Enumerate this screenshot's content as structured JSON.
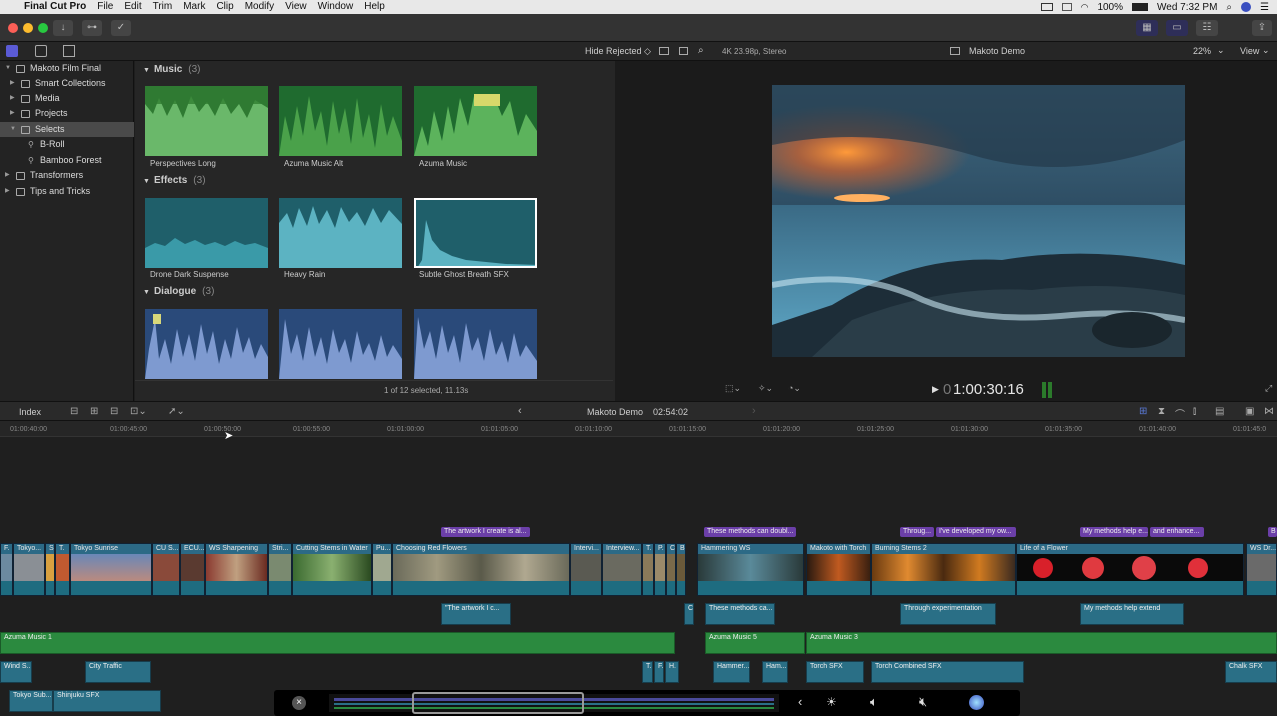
{
  "menubar": {
    "app": "Final Cut Pro",
    "items": [
      "File",
      "Edit",
      "Trim",
      "Mark",
      "Clip",
      "Modify",
      "View",
      "Window",
      "Help"
    ],
    "battery": "100%",
    "clock": "Wed 7:32 PM"
  },
  "bar2": {
    "hide_rejected": "Hide Rejected ◇",
    "format": "4K 23.98p, Stereo",
    "project": "Makoto Demo",
    "zoom": "22%",
    "view": "View"
  },
  "sidebar": {
    "items": [
      {
        "label": "Makoto Film Final",
        "selected": false
      },
      {
        "label": "Smart Collections",
        "selected": false
      },
      {
        "label": "Media",
        "selected": false
      },
      {
        "label": "Projects",
        "selected": false
      },
      {
        "label": "Selects",
        "selected": true
      },
      {
        "label": "B-Roll",
        "selected": false
      },
      {
        "label": "Bamboo Forest",
        "selected": false
      },
      {
        "label": "Transformers",
        "selected": false
      },
      {
        "label": "Tips and Tricks",
        "selected": false
      }
    ]
  },
  "browser": {
    "sections": [
      {
        "title": "Music",
        "count": "(3)",
        "clips": [
          "Perspectives Long",
          "Azuma Music Alt",
          "Azuma Music"
        ]
      },
      {
        "title": "Effects",
        "count": "(3)",
        "clips": [
          "Drone Dark Suspense",
          "Heavy Rain",
          "Subtle Ghost Breath SFX"
        ]
      },
      {
        "title": "Dialogue",
        "count": "(3)",
        "clips": [
          "",
          "",
          ""
        ]
      }
    ],
    "status": "1 of 12 selected, 11.13s"
  },
  "viewer": {
    "timecode": "1:00:30:16",
    "timecode_prefix": "0"
  },
  "timeline": {
    "index": "Index",
    "project": "Makoto Demo",
    "duration": "02:54:02",
    "ruler": [
      "01:00:40:00",
      "01:00:45:00",
      "01:00:50:00",
      "01:00:55:00",
      "01:01:00:00",
      "01:01:05:00",
      "01:01:10:00",
      "01:01:15:00",
      "01:01:20:00",
      "01:01:25:00",
      "01:01:30:00",
      "01:01:35:00",
      "01:01:40:00",
      "01:01:45:0"
    ],
    "titles": [
      "The artwork I create is al...",
      "These methods can doubl...",
      "Throug...",
      "I've developed my ow...",
      "My methods help e...",
      "and enhance...",
      "B"
    ],
    "primary": [
      "F.",
      "Tokyo...",
      "S.",
      "T.",
      "Tokyo Sunrise",
      "CU S...",
      "ECU...",
      "WS Sharpening",
      "Stri...",
      "Cutting Stems in Water",
      "Pu...",
      "Choosing Red Flowers",
      "Intervi...",
      "Interview...",
      "T.",
      "P.",
      "C",
      "B",
      "Hammering WS",
      "Makoto with Torch",
      "Burning Stems 2",
      "Life of a Flower",
      "WS Dr..."
    ],
    "connected": [
      "\"The artwork I c...",
      "C.",
      "These methods ca...",
      "Through experimentation",
      "My methods help extend"
    ],
    "music": [
      "Azuma Music 1",
      "Azuma Music 5",
      "Azuma Music 3"
    ],
    "sfx": [
      "Wind S...",
      "City Traffic",
      "T.",
      "F.",
      "H.",
      "Hammer...",
      "Ham...",
      "Torch SFX",
      "Torch Combined SFX",
      "Chalk SFX",
      "Tokyo Sub...",
      "Shinjuku SFX"
    ]
  }
}
